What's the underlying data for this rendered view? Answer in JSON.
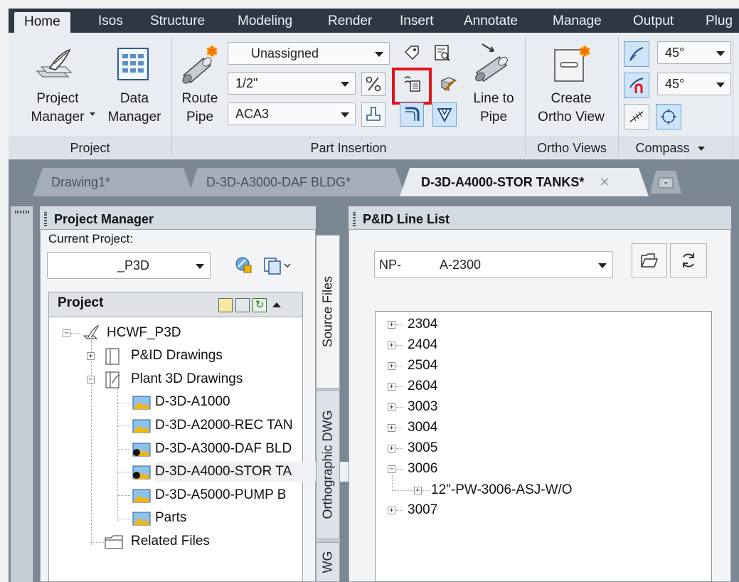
{
  "ribbon_tabs": [
    "Home",
    "Isos",
    "Structure",
    "Modeling",
    "Render",
    "Insert",
    "Annotate",
    "Manage",
    "Output",
    "Plug"
  ],
  "project_panel": {
    "title": "Project",
    "project_manager": "Project\nManager",
    "data_manager": "Data\nManager"
  },
  "part_insertion": {
    "title": "Part Insertion",
    "route_pipe": "Route\nPipe",
    "spec_combo": "Unassigned",
    "size_combo": "1/2\"",
    "spec_sheet_combo": "ACA3",
    "line_to_pipe": "Line to\nPipe"
  },
  "ortho_views": {
    "title": "Ortho Views",
    "create_ortho_view": "Create\nOrtho View"
  },
  "compass": {
    "title": "Compass",
    "angle1": "45°",
    "angle2": "45°"
  },
  "doc_tabs": [
    "Drawing1*",
    "D-3D-A3000-DAF BLDG*",
    "D-3D-A4000-STOR TANKS*"
  ],
  "project_manager": {
    "title": "Project Manager",
    "current_project_label": "Current Project:",
    "current_project_value": "_P3D",
    "tree_header": "Project",
    "tree": [
      {
        "label": "HCWF_P3D",
        "exp": "−"
      },
      {
        "label": "P&ID Drawings",
        "exp": "+"
      },
      {
        "label": "Plant 3D Drawings",
        "exp": "−"
      },
      {
        "label": "D-3D-A1000"
      },
      {
        "label": "D-3D-A2000-REC TAN"
      },
      {
        "label": "D-3D-A3000-DAF BLD"
      },
      {
        "label": "D-3D-A4000-STOR TA"
      },
      {
        "label": "D-3D-A5000-PUMP B"
      },
      {
        "label": "Parts"
      },
      {
        "label": "Related Files"
      }
    ],
    "side_tabs": [
      "Source Files",
      "Orthographic DWG",
      "WG"
    ]
  },
  "line_list": {
    "title": "P&ID Line List",
    "combo_prefix": "NP-",
    "combo_suffix": "A-2300",
    "items": [
      {
        "label": "2304",
        "exp": "+"
      },
      {
        "label": "2404",
        "exp": "+"
      },
      {
        "label": "2504",
        "exp": "+"
      },
      {
        "label": "2604",
        "exp": "+"
      },
      {
        "label": "3003",
        "exp": "+"
      },
      {
        "label": "3004",
        "exp": "+"
      },
      {
        "label": "3005",
        "exp": "+"
      },
      {
        "label": "3006",
        "exp": "−"
      },
      {
        "label": "12\"-PW-3006-ASJ-W/O",
        "exp": "+",
        "child": true
      },
      {
        "label": "3007",
        "exp": "+"
      }
    ]
  },
  "colors": {
    "ribbon_tab_bar": "#2e3744",
    "ribbon_body": "#e9edf2",
    "workspace": "#7c8794",
    "highlight_box": "#e0141e"
  }
}
